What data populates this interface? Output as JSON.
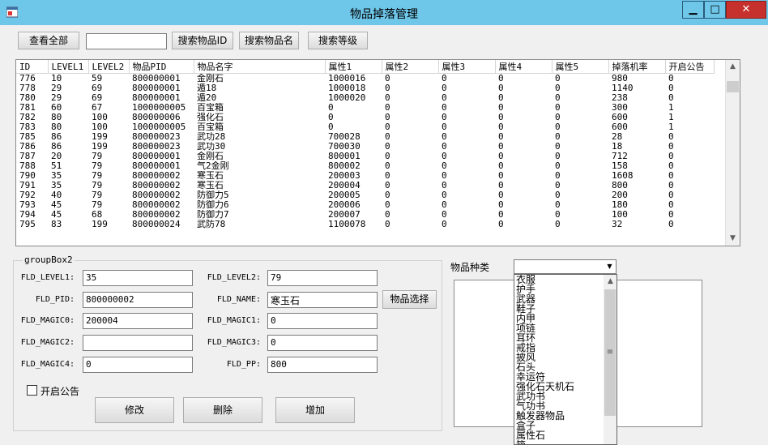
{
  "window": {
    "title": "物品掉落管理",
    "min_label": "▁",
    "max_label": "□",
    "close_label": "✕"
  },
  "toolbar": {
    "view_all": "查看全部",
    "search_value": "",
    "search_id": "搜索物品ID",
    "search_name": "搜索物品名",
    "search_level": "搜索等级"
  },
  "grid": {
    "columns": [
      "ID",
      "LEVEL1",
      "LEVEL2",
      "物品PID",
      "物品名字",
      "属性1",
      "属性2",
      "属性3",
      "属性4",
      "属性5",
      "掉落机率",
      "开启公告"
    ],
    "rows": [
      [
        "776",
        "10",
        "59",
        "800000001",
        "金刚石",
        "1000016",
        "0",
        "0",
        "0",
        "0",
        "980",
        "0"
      ],
      [
        "778",
        "29",
        "69",
        "800000001",
        "遁18",
        "1000018",
        "0",
        "0",
        "0",
        "0",
        "1140",
        "0"
      ],
      [
        "780",
        "29",
        "69",
        "800000001",
        "遁20",
        "1000020",
        "0",
        "0",
        "0",
        "0",
        "238",
        "0"
      ],
      [
        "781",
        "60",
        "67",
        "1000000005",
        "百宝箱",
        "0",
        "0",
        "0",
        "0",
        "0",
        "300",
        "1"
      ],
      [
        "782",
        "80",
        "100",
        "800000006",
        "强化石",
        "0",
        "0",
        "0",
        "0",
        "0",
        "600",
        "1"
      ],
      [
        "783",
        "80",
        "100",
        "1000000005",
        "百宝箱",
        "0",
        "0",
        "0",
        "0",
        "0",
        "600",
        "1"
      ],
      [
        "785",
        "86",
        "199",
        "800000023",
        "武功28",
        "700028",
        "0",
        "0",
        "0",
        "0",
        "28",
        "0"
      ],
      [
        "786",
        "86",
        "199",
        "800000023",
        "武功30",
        "700030",
        "0",
        "0",
        "0",
        "0",
        "18",
        "0"
      ],
      [
        "787",
        "20",
        "79",
        "800000001",
        "金刚石",
        "800001",
        "0",
        "0",
        "0",
        "0",
        "712",
        "0"
      ],
      [
        "788",
        "51",
        "79",
        "800000001",
        "气2金刚",
        "800002",
        "0",
        "0",
        "0",
        "0",
        "158",
        "0"
      ],
      [
        "790",
        "35",
        "79",
        "800000002",
        "寒玉石",
        "200003",
        "0",
        "0",
        "0",
        "0",
        "1608",
        "0"
      ],
      [
        "791",
        "35",
        "79",
        "800000002",
        "寒玉石",
        "200004",
        "0",
        "0",
        "0",
        "0",
        "800",
        "0"
      ],
      [
        "792",
        "40",
        "79",
        "800000002",
        "防御力5",
        "200005",
        "0",
        "0",
        "0",
        "0",
        "200",
        "0"
      ],
      [
        "793",
        "45",
        "79",
        "800000002",
        "防御力6",
        "200006",
        "0",
        "0",
        "0",
        "0",
        "180",
        "0"
      ],
      [
        "794",
        "45",
        "68",
        "800000002",
        "防御力7",
        "200007",
        "0",
        "0",
        "0",
        "0",
        "100",
        "0"
      ],
      [
        "795",
        "83",
        "199",
        "800000024",
        "武防78",
        "1100078",
        "0",
        "0",
        "0",
        "0",
        "32",
        "0"
      ]
    ]
  },
  "groupbox": {
    "title": "groupBox2",
    "fld_level1_label": "FLD_LEVEL1:",
    "fld_level1": "35",
    "fld_level2_label": "FLD_LEVEL2:",
    "fld_level2": "79",
    "fld_pid_label": "FLD_PID:",
    "fld_pid": "800000002",
    "fld_name_label": "FLD_NAME:",
    "fld_name": "寒玉石",
    "select_item": "物品选择",
    "fld_magic0_label": "FLD_MAGIC0:",
    "fld_magic0": "200004",
    "fld_magic1_label": "FLD_MAGIC1:",
    "fld_magic1": "0",
    "fld_magic2_label": "FLD_MAGIC2:",
    "fld_magic2": "",
    "fld_magic3_label": "FLD_MAGIC3:",
    "fld_magic3": "0",
    "fld_magic4_label": "FLD_MAGIC4:",
    "fld_magic4": "0",
    "fld_pp_label": "FLD_PP:",
    "fld_pp": "800",
    "announce_label": "开启公告",
    "modify": "修改",
    "delete": "删除",
    "add": "增加"
  },
  "category": {
    "label": "物品种类",
    "selected": "",
    "options": [
      "衣服",
      "护手",
      "武器",
      "鞋子",
      "内甲",
      "项链",
      "耳环",
      "戒指",
      "披风",
      "石头",
      "幸运符",
      "强化石天机石",
      "武功书",
      "气功书",
      "触发器物品",
      "盒子",
      "属性石",
      "箱"
    ]
  }
}
